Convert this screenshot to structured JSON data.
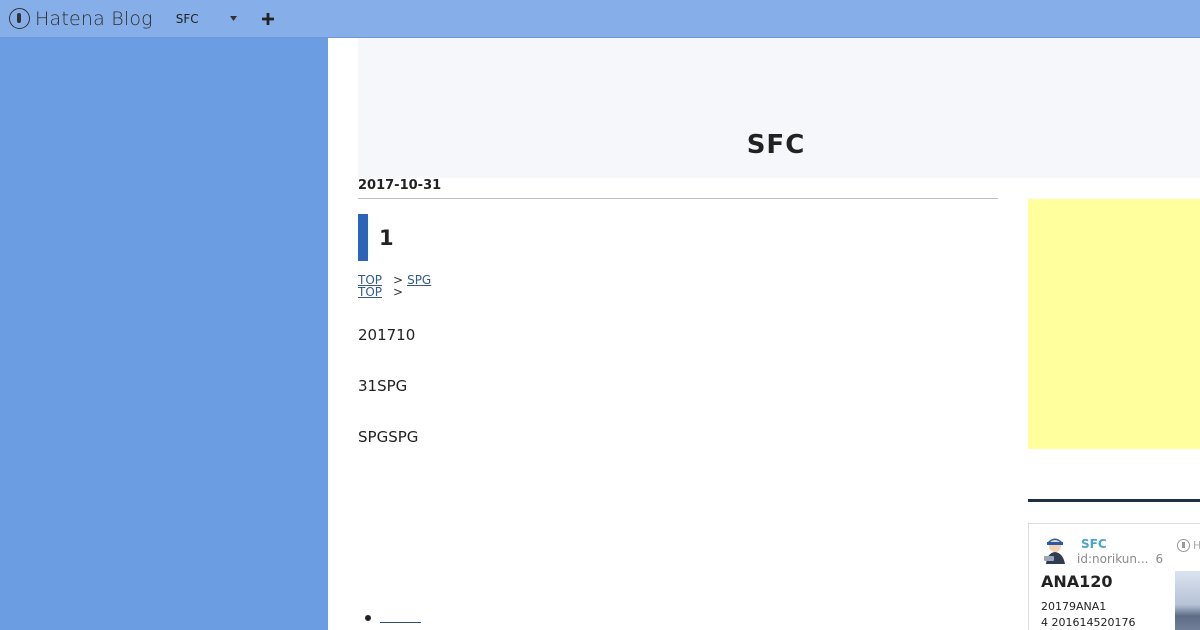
{
  "header": {
    "logo_text": "Hatena Blog",
    "blog_name": "SFC",
    "dropdown_icon": "chevron-down-icon",
    "add_icon": "plus-icon"
  },
  "blog": {
    "title": "SFC"
  },
  "article": {
    "date": "2017-10-31",
    "title": "1",
    "breadcrumbs": [
      {
        "link": "TOP",
        "sep": ">",
        "child": "SPG"
      },
      {
        "link": "TOP",
        "sep": ">",
        "child": ""
      }
    ],
    "paragraphs": [
      "201710",
      "31SPG",
      "SPGSPG"
    ]
  },
  "sidebar": {
    "profile": {
      "name": "SFC",
      "id": "id:norikun...",
      "count": "6",
      "hatena_label": "H",
      "card_title": "ANA120",
      "card_text_lines": [
        "20179ANA1",
        "4 201614520176"
      ]
    }
  },
  "colors": {
    "header_bg": "#86aee8",
    "left_band": "#6a9de2",
    "accent_bar": "#2b64b8",
    "ad_bg": "#ffff9d",
    "profile_name": "#4aa5c8"
  }
}
